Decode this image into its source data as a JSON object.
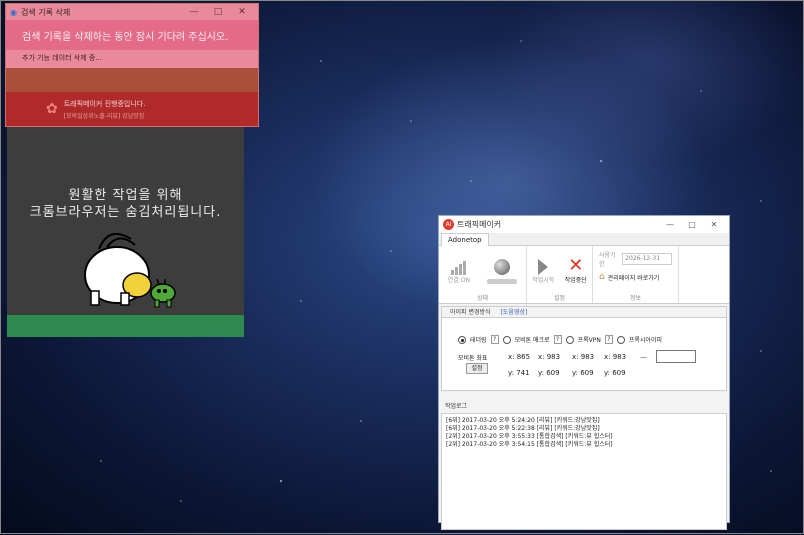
{
  "delete_dialog": {
    "title": "검색 기록 삭제",
    "ctrl_minimize": "—",
    "ctrl_maximize": "□",
    "ctrl_close": "✕",
    "message": "검색 기록을 삭제하는 동안 잠시 기다려 주십시오.",
    "subtext": "추가 기능 데이터 삭제 중...",
    "busy_line1": "트래픽메이커 진행중입니다.",
    "busy_line2": "[모바일상위노출-리뷰] 강남맛집"
  },
  "notice": {
    "line1": "원활한 작업을 위해",
    "line2": "크롬브라우저는 숨김처리됩니다."
  },
  "trafficmaker": {
    "title": "트래픽메이커",
    "icon_text": "AI",
    "ctrl_minimize": "—",
    "ctrl_maximize": "□",
    "ctrl_close": "✕",
    "tab": "Adonetop",
    "ribbon": {
      "connect_label": "연결:ON",
      "group_status": "상태",
      "start_label": "작업시작",
      "stop_label": "작업중단",
      "group_settings": "설정",
      "expiry_label": "사용기한",
      "expiry_value": "2026-12-31",
      "admin_label": "관리페이지 바로가기",
      "group_info": "정보"
    },
    "subtabs": [
      "아이피 변경방식",
      "[도움영상]"
    ],
    "options": [
      {
        "label": "테더링",
        "selected": true
      },
      {
        "label": "모비톤 매크로",
        "selected": false
      },
      {
        "label": "프록VPN",
        "selected": false
      },
      {
        "label": "프록시아이피",
        "selected": false
      }
    ],
    "help_q": "?",
    "coord_label": "모비톤 좌표",
    "set_button": "설정",
    "coords_x": [
      "x: 865",
      "x: 983",
      "x: 983",
      "x: 983"
    ],
    "coords_y": [
      "y: 741",
      "y: 609",
      "y: 609",
      "y: 609"
    ],
    "dash": "—",
    "log_label": "작업로그",
    "log": [
      "[6위] 2017-03-20 오후 5:24:20  [리뷰] [키워드:강남맛집]",
      "[6위] 2017-03-20 오후 5:22:38  [리뷰] [키워드:강남맛집]",
      "[2위] 2017-03-20 오후 3:55:33  [통합검색] [키워드:뷰 힙스터]",
      "[2위] 2017-03-20 오후 3:54:15  [통합검색] [키워드:뷰 힙스터]"
    ]
  },
  "colors": {
    "delete_bg": "#e88a9a",
    "busy_bg": "#b02a2a",
    "notice_bg": "#3d3d3d",
    "notice_bar": "#2f8a4f",
    "accent_red": "#e23b2e"
  }
}
